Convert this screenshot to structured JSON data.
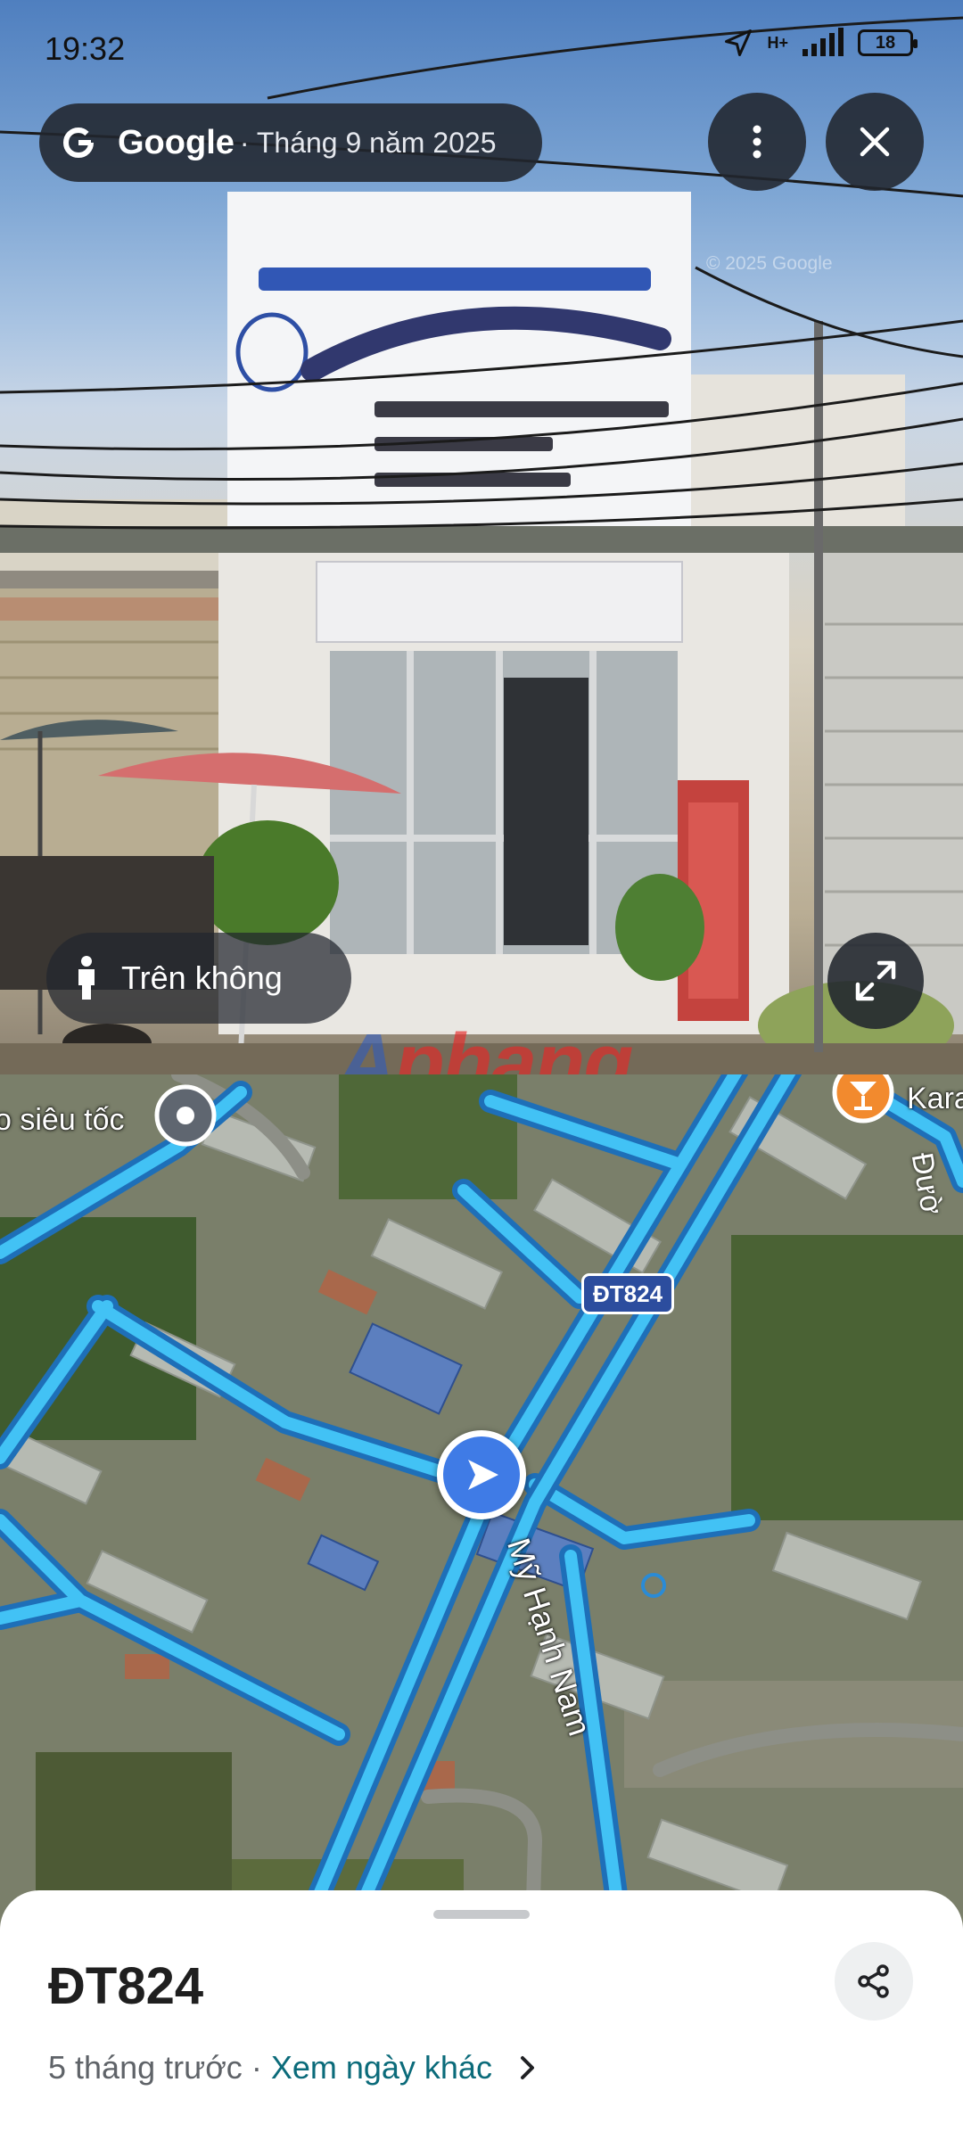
{
  "status_bar": {
    "time": "19:32",
    "network": "H+",
    "battery": "18"
  },
  "top_bar": {
    "brand": "Google",
    "date": "· Tháng 9 năm 2025"
  },
  "street_view": {
    "copyright": "© 2025 Google",
    "watermark": "Aphang",
    "overhead_label": "Trên không"
  },
  "map": {
    "poi_label": "o siêu tốc",
    "poi_label_right": "Kara",
    "road_shield": "ĐT824",
    "street_name": "Mỹ Hạnh Nam",
    "street_name_right": "Đườ"
  },
  "sheet": {
    "title": "ĐT824",
    "relative_time": "5 tháng trước ·",
    "other_dates": "Xem ngày khác"
  },
  "colors": {
    "road_blue": "#29b6f6",
    "marker_blue": "#3f7be6",
    "link_teal": "#0b6b7a",
    "chip_dark": "#21262e"
  }
}
